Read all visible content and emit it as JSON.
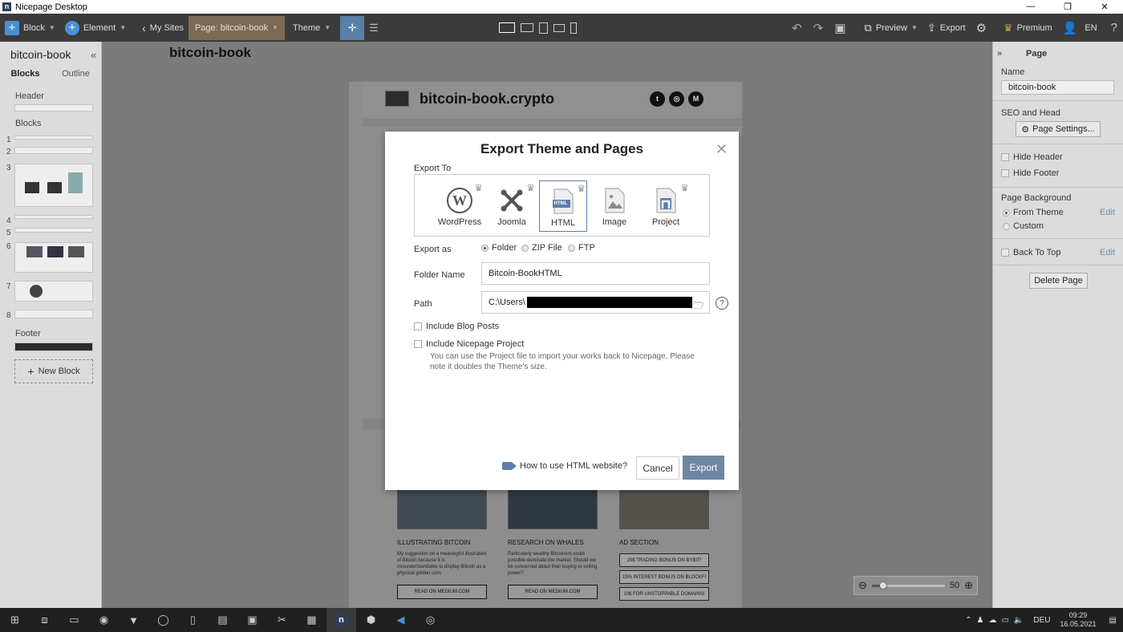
{
  "window": {
    "title": "Nicepage Desktop",
    "app_icon": "n"
  },
  "toolbar": {
    "block_label": "Block",
    "element_label": "Element",
    "my_sites_label": "My Sites",
    "page_label": "Page: bitcoin-book",
    "theme_label": "Theme",
    "preview_label": "Preview",
    "export_label": "Export",
    "premium_label": "Premium",
    "lang_label": "EN"
  },
  "left_panel": {
    "site_name": "bitcoin-book",
    "tabs": [
      "Blocks",
      "Outline"
    ],
    "header_label": "Header",
    "blocks_label": "Blocks",
    "block_numbers": [
      "1",
      "2",
      "3",
      "4",
      "5",
      "6",
      "7",
      "8"
    ],
    "footer_label": "Footer",
    "new_block_label": "New Block"
  },
  "canvas": {
    "page_title": "bitcoin-book",
    "site_name": "bitcoin-book.crypto",
    "social_icons": [
      "twitter-icon",
      "instagram-icon",
      "medium-icon"
    ],
    "social_glyphs": [
      "t",
      "◎",
      "M"
    ],
    "cards": [
      {
        "title": "ILLUSTRATING BITCOIN",
        "text": "My suggestion on a meaningful illustration of Bitcoin because it is misunderstandable to display Bitcoin as a physical golden coin.",
        "button": "READ ON MEDIUM.COM"
      },
      {
        "title": "RESEARCH ON WHALES",
        "text": "Particularly wealthy Bitcoiners could possible dominate the market. Should we be concerned about their buying or selling power?",
        "button": "READ ON MEDIUM.COM"
      }
    ],
    "ad_section": {
      "title": "AD SECTION",
      "buttons": [
        "15$ TRADING BONUS ON BYBIT!",
        "15% INTEREST BONUS ON BLOCKFI",
        "10$ FOR UNSTOPPABLE DOMAINS!"
      ]
    },
    "zoom": {
      "value": "50",
      "level": 0.5
    }
  },
  "right_panel": {
    "title": "Page",
    "name_label": "Name",
    "name_value": "bitcoin-book",
    "seo_label": "SEO and Head",
    "page_settings_label": "Page Settings...",
    "hide_header_label": "Hide Header",
    "hide_footer_label": "Hide Footer",
    "page_background_label": "Page Background",
    "from_theme_label": "From Theme",
    "custom_label": "Custom",
    "edit_label": "Edit",
    "back_to_top_label": "Back To Top",
    "delete_page_label": "Delete Page"
  },
  "modal": {
    "title": "Export Theme and Pages",
    "export_to_label": "Export To",
    "targets": [
      {
        "name": "WordPress",
        "icon": "wordpress-icon",
        "premium": true
      },
      {
        "name": "Joomla",
        "icon": "joomla-icon",
        "premium": true
      },
      {
        "name": "HTML",
        "icon": "html-file-icon",
        "premium": true,
        "selected": true
      },
      {
        "name": "Image",
        "icon": "image-file-icon",
        "premium": false
      },
      {
        "name": "Project",
        "icon": "project-file-icon",
        "premium": true
      }
    ],
    "html_badge": "HTML",
    "export_as_label": "Export as",
    "export_as_options": [
      "Folder",
      "ZIP File",
      "FTP"
    ],
    "export_as_selected": "Folder",
    "folder_name_label": "Folder Name",
    "folder_name_value": "Bitcoin-BookHTML",
    "path_label": "Path",
    "path_value": "C:\\Users\\",
    "include_blog_posts_label": "Include Blog Posts",
    "include_project_label": "Include Nicepage Project",
    "project_note": "You can use the Project file to import your works back to Nicepage. Please note it doubles the Theme's size.",
    "how_to_label": "How to use HTML website?",
    "cancel_label": "Cancel",
    "export_label": "Export"
  },
  "taskbar": {
    "language": "DEU",
    "time": "09:29",
    "date": "16.05.2021"
  },
  "colors": {
    "accent": "#5b7fa8",
    "toolbar_bg": "#3b3b3b",
    "page_tab_bg": "#7a6b55",
    "export_button": "#6f86a2"
  }
}
